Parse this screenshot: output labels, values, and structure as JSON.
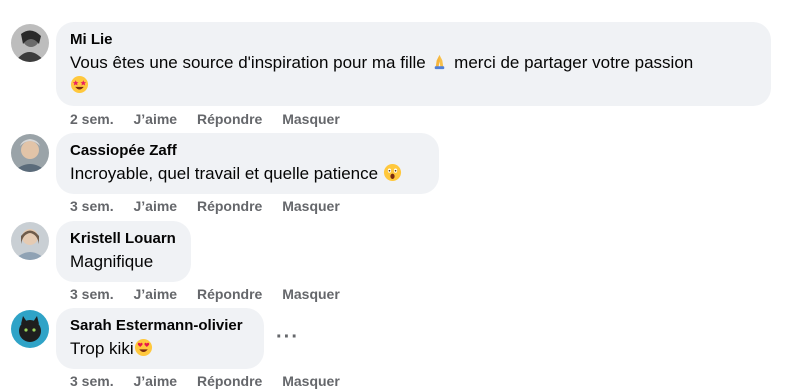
{
  "comments": [
    {
      "author": "Mi Lie",
      "text_1": "Vous êtes une source d'inspiration pour ma fille ",
      "text_2": " merci de partager votre passion",
      "emoji_1": "folded-hands-emoji",
      "emoji_2": "star-struck-emoji",
      "time": "2 sem.",
      "like": "J’aime",
      "reply": "Répondre",
      "hide": "Masquer"
    },
    {
      "author": "Cassiopée Zaff",
      "text_1": "Incroyable, quel travail et quelle patience ",
      "emoji_1": "astonished-face-emoji",
      "time": "3 sem.",
      "like": "J’aime",
      "reply": "Répondre",
      "hide": "Masquer"
    },
    {
      "author": "Kristell Louarn",
      "text_1": "Magnifique",
      "time": "3 sem.",
      "like": "J’aime",
      "reply": "Répondre",
      "hide": "Masquer"
    },
    {
      "author": "Sarah Estermann-olivier",
      "text_1": "Trop kiki",
      "emoji_1": "heart-eyes-emoji",
      "more": "···",
      "time": "3 sem.",
      "like": "J’aime",
      "reply": "Répondre",
      "hide": "Masquer"
    }
  ]
}
